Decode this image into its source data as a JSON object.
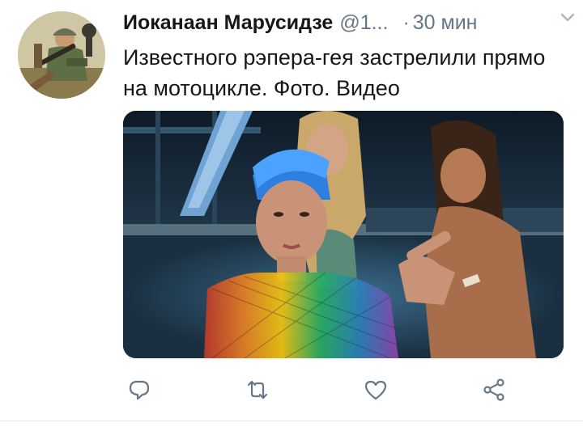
{
  "tweet": {
    "author": {
      "display_name": "Иоканаан Марусидзе",
      "handle": "@1...",
      "avatar_icon": "avatar-illustration-soldier"
    },
    "separator": "·",
    "timestamp": "30 мин",
    "text": "Известного рэпера-гея застрелили прямо на мотоцикле. Фото. Видео",
    "media": {
      "type": "photo"
    },
    "actions": {
      "reply_icon": "reply-icon",
      "retweet_icon": "retweet-icon",
      "like_icon": "heart-icon",
      "share_icon": "share-icon"
    },
    "colors": {
      "text": "#14171a",
      "secondary": "#657786",
      "icon": "#657786"
    }
  }
}
